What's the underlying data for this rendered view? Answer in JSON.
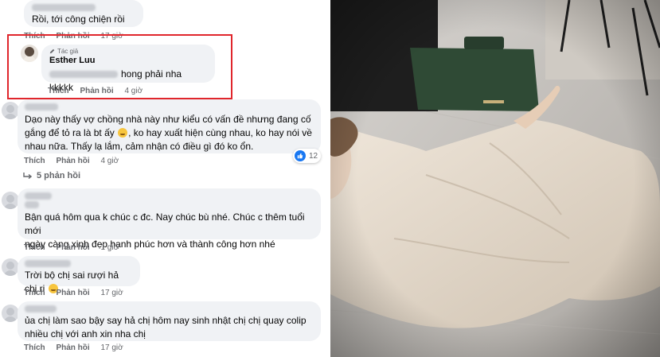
{
  "comments": [
    {
      "id": "c1",
      "text": "Rồi, tới công chiện rồi",
      "actions": {
        "like": "Thích",
        "reply": "Phản hồi",
        "time": "17 giờ"
      }
    },
    {
      "id": "c2",
      "author_badge": "Tác giả",
      "author": "Esther Luu",
      "text": "hong phải nha kkkkk",
      "actions": {
        "like": "Thích",
        "reply": "Phản hồi",
        "time": "4 giờ"
      }
    },
    {
      "id": "c3",
      "text_line1": "Dạo này thấy vợ chồng nhà này như kiểu có vấn đề nhưng đang cố",
      "text_line2a": "gắng để tỏ ra là bt ấy",
      "text_line2b": ", ko hay xuất hiện cùng nhau, ko hay nói về",
      "text_line3": "nhau nữa. Thấy lạ lắm, cảm nhận có điều gì đó ko ổn.",
      "reaction_count": "12",
      "actions": {
        "like": "Thích",
        "reply": "Phản hồi",
        "time": "4 giờ"
      },
      "replies_label": "5 phản hồi"
    },
    {
      "id": "c4",
      "text_line1": "Bận quá hôm qua k chúc c đc. Nay chúc bù nhé. Chúc c thêm tuổi mới",
      "text_line2": "ngày càng xinh đẹp hạnh phúc hơn và thành công hơn nhé",
      "actions": {
        "like": "Thích",
        "reply": "Phản hồi",
        "time": "1 giờ"
      }
    },
    {
      "id": "c5",
      "text": "Trời bộ chị sai rượi hả chị ri",
      "actions": {
        "like": "Thích",
        "reply": "Phản hồi",
        "time": "17 giờ"
      }
    },
    {
      "id": "c6",
      "text_line1": "ủa chị làm sao bậy say hả chị hôm nay sinh nhật chị chị quay colip",
      "text_line2": "nhiều chị với anh xin nha chị",
      "actions": {
        "like": "Thích",
        "reply": "Phản hồi",
        "time": "17 giờ"
      }
    }
  ],
  "icons": {
    "author_badge": "pencil-icon",
    "reaction": "like-icon",
    "replies": "reply-arrow-icon"
  },
  "colors": {
    "highlight_border": "#e0262c",
    "bubble": "#f0f2f5",
    "like_blue": "#1877f2",
    "meta_text": "#65676b"
  }
}
